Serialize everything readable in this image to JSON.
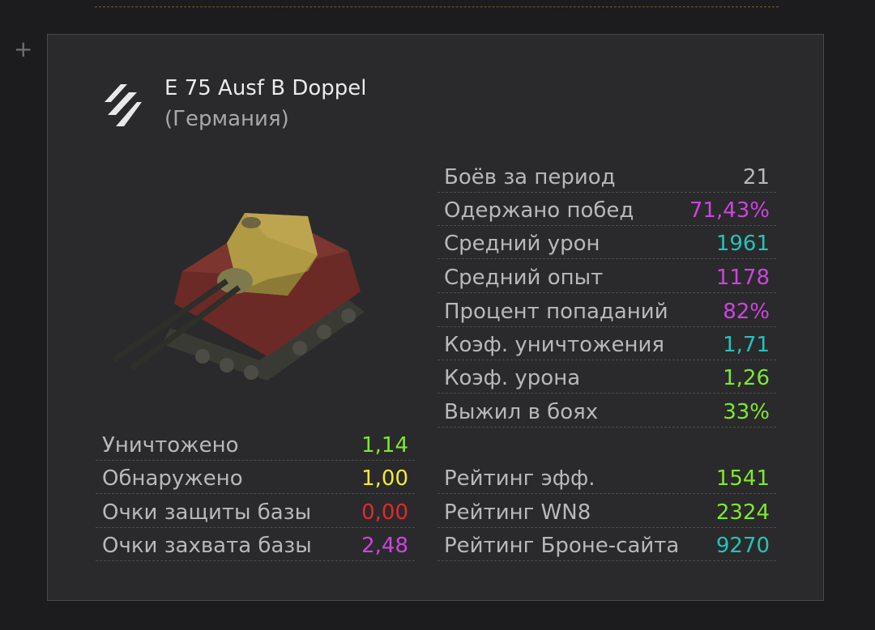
{
  "tank": {
    "name": "E 75 Ausf B Doppel",
    "nation": "(Германия)",
    "tier_icon": "tier-stripes-icon"
  },
  "right_stats": [
    {
      "label": "Боёв за период",
      "value": "21",
      "color": "#b8b8b8"
    },
    {
      "label": "Одержано побед",
      "value": "71,43%",
      "color": "#cc44dd"
    },
    {
      "label": "Средний урон",
      "value": "1961",
      "color": "#22c4b8"
    },
    {
      "label": "Средний опыт",
      "value": "1178",
      "color": "#cc44dd"
    },
    {
      "label": "Процент попаданий",
      "value": "82%",
      "color": "#cc44dd"
    },
    {
      "label": "Коэф. уничтожения",
      "value": "1,71",
      "color": "#22c4b8"
    },
    {
      "label": "Коэф. урона",
      "value": "1,26",
      "color": "#7ee82e"
    },
    {
      "label": "Выжил в боях",
      "value": "33%",
      "color": "#7ee82e"
    }
  ],
  "left_stats": [
    {
      "label": "Уничтожено",
      "value": "1,14",
      "color": "#7ee82e"
    },
    {
      "label": "Обнаружено",
      "value": "1,00",
      "color": "#f2e83a"
    },
    {
      "label": "Очки защиты базы",
      "value": "0,00",
      "color": "#e02a2a"
    },
    {
      "label": "Очки захвата базы",
      "value": "2,48",
      "color": "#cc44dd"
    }
  ],
  "ratings": [
    {
      "label": "Рейтинг эфф.",
      "value": "1541",
      "color": "#7ee82e"
    },
    {
      "label": "Рейтинг WN8",
      "value": "2324",
      "color": "#7ee82e"
    },
    {
      "label": "Рейтинг Броне-сайта",
      "value": "9270",
      "color": "#22c4b8"
    }
  ]
}
